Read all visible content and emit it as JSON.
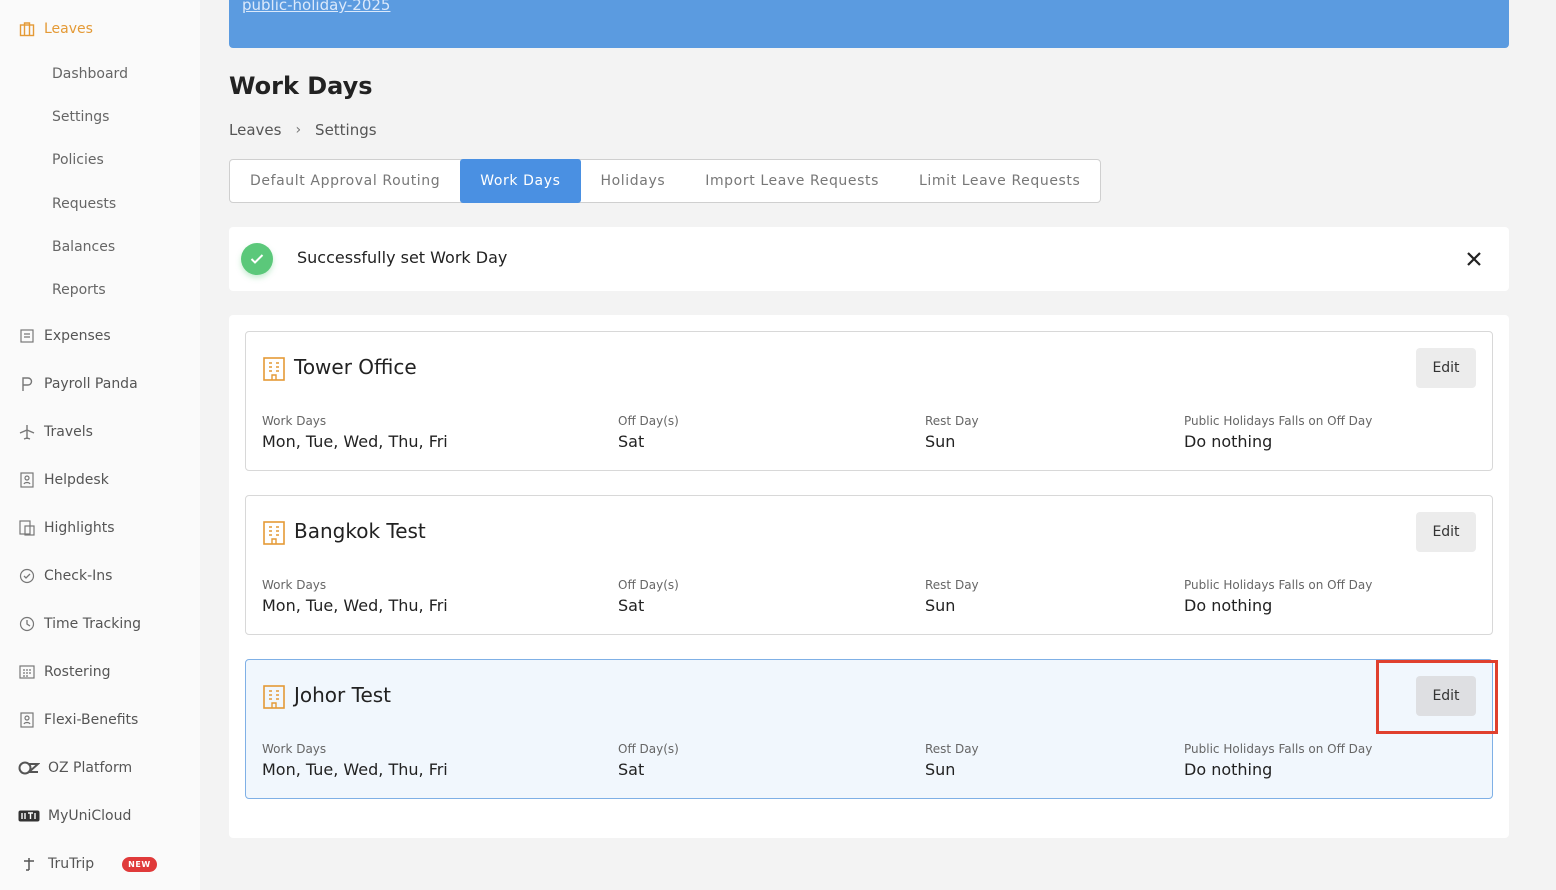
{
  "sidebar": {
    "leaves": {
      "label": "Leaves",
      "sub": [
        "Dashboard",
        "Settings",
        "Policies",
        "Requests",
        "Balances",
        "Reports"
      ]
    },
    "items": [
      {
        "label": "Expenses",
        "icon": "receipt-icon"
      },
      {
        "label": "Payroll Panda",
        "icon": "payroll-p-icon"
      },
      {
        "label": "Travels",
        "icon": "plane-icon"
      },
      {
        "label": "Helpdesk",
        "icon": "helpdesk-icon"
      },
      {
        "label": "Highlights",
        "icon": "highlights-icon"
      },
      {
        "label": "Check-Ins",
        "icon": "check-circle-icon"
      },
      {
        "label": "Time Tracking",
        "icon": "clock-icon"
      },
      {
        "label": "Rostering",
        "icon": "calendar-grid-icon"
      },
      {
        "label": "Flexi-Benefits",
        "icon": "benefits-icon"
      },
      {
        "label": "OZ Platform",
        "icon": "oz-logo-icon"
      },
      {
        "label": "MyUniCloud",
        "icon": "unicloud-logo-icon"
      },
      {
        "label": "TruTrip",
        "icon": "trutrip-logo-icon",
        "badge": "NEW"
      }
    ]
  },
  "banner": {
    "link_text": "public-holiday-2025"
  },
  "page": {
    "title": "Work Days",
    "breadcrumb": [
      "Leaves",
      "Settings"
    ]
  },
  "tabs": [
    {
      "label": "Default Approval Routing",
      "active": false
    },
    {
      "label": "Work Days",
      "active": true
    },
    {
      "label": "Holidays",
      "active": false
    },
    {
      "label": "Import Leave Requests",
      "active": false
    },
    {
      "label": "Limit Leave Requests",
      "active": false
    }
  ],
  "toast": {
    "message": "Successfully set Work Day"
  },
  "labels": {
    "work_days": "Work Days",
    "off_days": "Off Day(s)",
    "rest_day": "Rest Day",
    "ph_off": "Public Holidays Falls on Off Day",
    "edit": "Edit"
  },
  "offices": [
    {
      "name": "Tower Office",
      "work_days": "Mon, Tue, Wed, Thu, Fri",
      "off_days": "Sat",
      "rest_day": "Sun",
      "ph_off": "Do nothing"
    },
    {
      "name": "Bangkok Test",
      "work_days": "Mon, Tue, Wed, Thu, Fri",
      "off_days": "Sat",
      "rest_day": "Sun",
      "ph_off": "Do nothing"
    },
    {
      "name": "Johor Test",
      "work_days": "Mon, Tue, Wed, Thu, Fri",
      "off_days": "Sat",
      "rest_day": "Sun",
      "ph_off": "Do nothing"
    }
  ],
  "colors": {
    "accent": "#e49a36",
    "tab_active": "#4a90e2",
    "banner": "#5b9be0",
    "success": "#5bc87a",
    "highlight": "#e0402e"
  }
}
